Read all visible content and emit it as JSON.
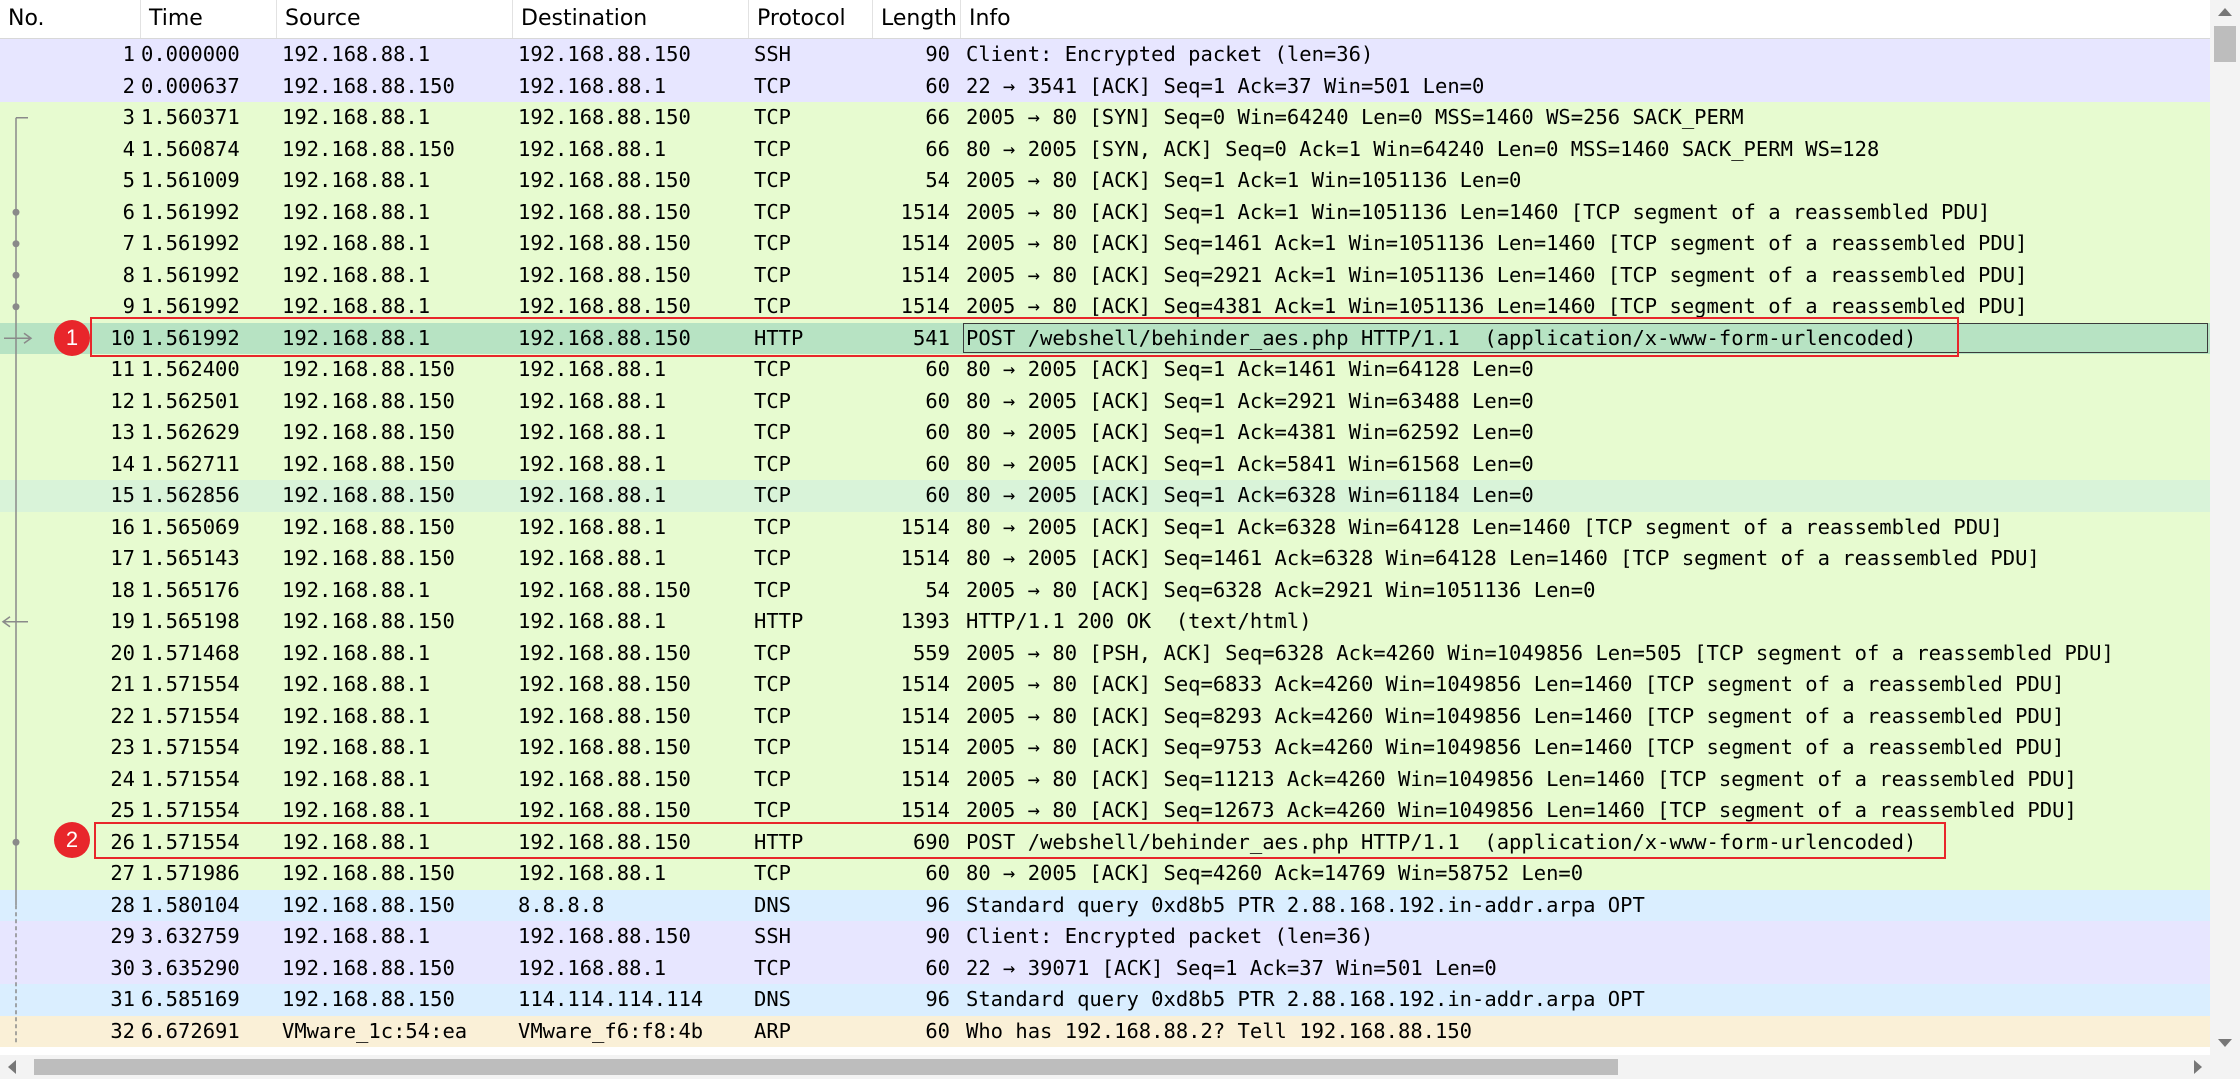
{
  "columns": {
    "no": "No.",
    "time": "Time",
    "source": "Source",
    "destination": "Destination",
    "protocol": "Protocol",
    "length": "Length",
    "info": "Info"
  },
  "annotations": [
    "1",
    "2"
  ],
  "colors": {
    "ssh": "#e7e6ff",
    "tcp": "#e7fbd0",
    "http_request": "#b7e3c3",
    "tcp_alt": "#d9f3d9",
    "dns": "#daeeff",
    "arp": "#faf0d7",
    "annotation": "#e8262b"
  },
  "packets": [
    {
      "no": "1",
      "time": "0.000000",
      "src": "192.168.88.1",
      "dst": "192.168.88.150",
      "proto": "SSH",
      "len": "90",
      "info": "Client: Encrypted packet (len=36)",
      "bg": "#e7e6ff"
    },
    {
      "no": "2",
      "time": "0.000637",
      "src": "192.168.88.150",
      "dst": "192.168.88.1",
      "proto": "TCP",
      "len": "60",
      "info": "22 → 3541 [ACK] Seq=1 Ack=37 Win=501 Len=0",
      "bg": "#e7e6ff"
    },
    {
      "no": "3",
      "time": "1.560371",
      "src": "192.168.88.1",
      "dst": "192.168.88.150",
      "proto": "TCP",
      "len": "66",
      "info": "2005 → 80 [SYN] Seq=0 Win=64240 Len=0 MSS=1460 WS=256 SACK_PERM",
      "bg": "#e7fbd0"
    },
    {
      "no": "4",
      "time": "1.560874",
      "src": "192.168.88.150",
      "dst": "192.168.88.1",
      "proto": "TCP",
      "len": "66",
      "info": "80 → 2005 [SYN, ACK] Seq=0 Ack=1 Win=64240 Len=0 MSS=1460 SACK_PERM WS=128",
      "bg": "#e7fbd0"
    },
    {
      "no": "5",
      "time": "1.561009",
      "src": "192.168.88.1",
      "dst": "192.168.88.150",
      "proto": "TCP",
      "len": "54",
      "info": "2005 → 80 [ACK] Seq=1 Ack=1 Win=1051136 Len=0",
      "bg": "#e7fbd0"
    },
    {
      "no": "6",
      "time": "1.561992",
      "src": "192.168.88.1",
      "dst": "192.168.88.150",
      "proto": "TCP",
      "len": "1514",
      "info": "2005 → 80 [ACK] Seq=1 Ack=1 Win=1051136 Len=1460 [TCP segment of a reassembled PDU]",
      "bg": "#e7fbd0"
    },
    {
      "no": "7",
      "time": "1.561992",
      "src": "192.168.88.1",
      "dst": "192.168.88.150",
      "proto": "TCP",
      "len": "1514",
      "info": "2005 → 80 [ACK] Seq=1461 Ack=1 Win=1051136 Len=1460 [TCP segment of a reassembled PDU]",
      "bg": "#e7fbd0"
    },
    {
      "no": "8",
      "time": "1.561992",
      "src": "192.168.88.1",
      "dst": "192.168.88.150",
      "proto": "TCP",
      "len": "1514",
      "info": "2005 → 80 [ACK] Seq=2921 Ack=1 Win=1051136 Len=1460 [TCP segment of a reassembled PDU]",
      "bg": "#e7fbd0"
    },
    {
      "no": "9",
      "time": "1.561992",
      "src": "192.168.88.1",
      "dst": "192.168.88.150",
      "proto": "TCP",
      "len": "1514",
      "info": "2005 → 80 [ACK] Seq=4381 Ack=1 Win=1051136 Len=1460 [TCP segment of a reassembled PDU]",
      "bg": "#e7fbd0"
    },
    {
      "no": "10",
      "time": "1.561992",
      "src": "192.168.88.1",
      "dst": "192.168.88.150",
      "proto": "HTTP",
      "len": "541",
      "info": "POST /webshell/behinder_aes.php HTTP/1.1  (application/x-www-form-urlencoded)",
      "bg": "#b7e3c3",
      "selected": true
    },
    {
      "no": "11",
      "time": "1.562400",
      "src": "192.168.88.150",
      "dst": "192.168.88.1",
      "proto": "TCP",
      "len": "60",
      "info": "80 → 2005 [ACK] Seq=1 Ack=1461 Win=64128 Len=0",
      "bg": "#e7fbd0"
    },
    {
      "no": "12",
      "time": "1.562501",
      "src": "192.168.88.150",
      "dst": "192.168.88.1",
      "proto": "TCP",
      "len": "60",
      "info": "80 → 2005 [ACK] Seq=1 Ack=2921 Win=63488 Len=0",
      "bg": "#e7fbd0"
    },
    {
      "no": "13",
      "time": "1.562629",
      "src": "192.168.88.150",
      "dst": "192.168.88.1",
      "proto": "TCP",
      "len": "60",
      "info": "80 → 2005 [ACK] Seq=1 Ack=4381 Win=62592 Len=0",
      "bg": "#e7fbd0"
    },
    {
      "no": "14",
      "time": "1.562711",
      "src": "192.168.88.150",
      "dst": "192.168.88.1",
      "proto": "TCP",
      "len": "60",
      "info": "80 → 2005 [ACK] Seq=1 Ack=5841 Win=61568 Len=0",
      "bg": "#e7fbd0"
    },
    {
      "no": "15",
      "time": "1.562856",
      "src": "192.168.88.150",
      "dst": "192.168.88.1",
      "proto": "TCP",
      "len": "60",
      "info": "80 → 2005 [ACK] Seq=1 Ack=6328 Win=61184 Len=0",
      "bg": "#d9f3d9"
    },
    {
      "no": "16",
      "time": "1.565069",
      "src": "192.168.88.150",
      "dst": "192.168.88.1",
      "proto": "TCP",
      "len": "1514",
      "info": "80 → 2005 [ACK] Seq=1 Ack=6328 Win=64128 Len=1460 [TCP segment of a reassembled PDU]",
      "bg": "#e7fbd0"
    },
    {
      "no": "17",
      "time": "1.565143",
      "src": "192.168.88.150",
      "dst": "192.168.88.1",
      "proto": "TCP",
      "len": "1514",
      "info": "80 → 2005 [ACK] Seq=1461 Ack=6328 Win=64128 Len=1460 [TCP segment of a reassembled PDU]",
      "bg": "#e7fbd0"
    },
    {
      "no": "18",
      "time": "1.565176",
      "src": "192.168.88.1",
      "dst": "192.168.88.150",
      "proto": "TCP",
      "len": "54",
      "info": "2005 → 80 [ACK] Seq=6328 Ack=2921 Win=1051136 Len=0",
      "bg": "#e7fbd0"
    },
    {
      "no": "19",
      "time": "1.565198",
      "src": "192.168.88.150",
      "dst": "192.168.88.1",
      "proto": "HTTP",
      "len": "1393",
      "info": "HTTP/1.1 200 OK  (text/html)",
      "bg": "#e7fbd0"
    },
    {
      "no": "20",
      "time": "1.571468",
      "src": "192.168.88.1",
      "dst": "192.168.88.150",
      "proto": "TCP",
      "len": "559",
      "info": "2005 → 80 [PSH, ACK] Seq=6328 Ack=4260 Win=1049856 Len=505 [TCP segment of a reassembled PDU]",
      "bg": "#e7fbd0"
    },
    {
      "no": "21",
      "time": "1.571554",
      "src": "192.168.88.1",
      "dst": "192.168.88.150",
      "proto": "TCP",
      "len": "1514",
      "info": "2005 → 80 [ACK] Seq=6833 Ack=4260 Win=1049856 Len=1460 [TCP segment of a reassembled PDU]",
      "bg": "#e7fbd0"
    },
    {
      "no": "22",
      "time": "1.571554",
      "src": "192.168.88.1",
      "dst": "192.168.88.150",
      "proto": "TCP",
      "len": "1514",
      "info": "2005 → 80 [ACK] Seq=8293 Ack=4260 Win=1049856 Len=1460 [TCP segment of a reassembled PDU]",
      "bg": "#e7fbd0"
    },
    {
      "no": "23",
      "time": "1.571554",
      "src": "192.168.88.1",
      "dst": "192.168.88.150",
      "proto": "TCP",
      "len": "1514",
      "info": "2005 → 80 [ACK] Seq=9753 Ack=4260 Win=1049856 Len=1460 [TCP segment of a reassembled PDU]",
      "bg": "#e7fbd0"
    },
    {
      "no": "24",
      "time": "1.571554",
      "src": "192.168.88.1",
      "dst": "192.168.88.150",
      "proto": "TCP",
      "len": "1514",
      "info": "2005 → 80 [ACK] Seq=11213 Ack=4260 Win=1049856 Len=1460 [TCP segment of a reassembled PDU]",
      "bg": "#e7fbd0"
    },
    {
      "no": "25",
      "time": "1.571554",
      "src": "192.168.88.1",
      "dst": "192.168.88.150",
      "proto": "TCP",
      "len": "1514",
      "info": "2005 → 80 [ACK] Seq=12673 Ack=4260 Win=1049856 Len=1460 [TCP segment of a reassembled PDU]",
      "bg": "#e7fbd0"
    },
    {
      "no": "26",
      "time": "1.571554",
      "src": "192.168.88.1",
      "dst": "192.168.88.150",
      "proto": "HTTP",
      "len": "690",
      "info": "POST /webshell/behinder_aes.php HTTP/1.1  (application/x-www-form-urlencoded)",
      "bg": "#e7fbd0"
    },
    {
      "no": "27",
      "time": "1.571986",
      "src": "192.168.88.150",
      "dst": "192.168.88.1",
      "proto": "TCP",
      "len": "60",
      "info": "80 → 2005 [ACK] Seq=4260 Ack=14769 Win=58752 Len=0",
      "bg": "#e7fbd0"
    },
    {
      "no": "28",
      "time": "1.580104",
      "src": "192.168.88.150",
      "dst": "8.8.8.8",
      "proto": "DNS",
      "len": "96",
      "info": "Standard query 0xd8b5 PTR 2.88.168.192.in-addr.arpa OPT",
      "bg": "#daeeff"
    },
    {
      "no": "29",
      "time": "3.632759",
      "src": "192.168.88.1",
      "dst": "192.168.88.150",
      "proto": "SSH",
      "len": "90",
      "info": "Client: Encrypted packet (len=36)",
      "bg": "#e7e6ff"
    },
    {
      "no": "30",
      "time": "3.635290",
      "src": "192.168.88.150",
      "dst": "192.168.88.1",
      "proto": "TCP",
      "len": "60",
      "info": "22 → 39071 [ACK] Seq=1 Ack=37 Win=501 Len=0",
      "bg": "#e7e6ff"
    },
    {
      "no": "31",
      "time": "6.585169",
      "src": "192.168.88.150",
      "dst": "114.114.114.114",
      "proto": "DNS",
      "len": "96",
      "info": "Standard query 0xd8b5 PTR 2.88.168.192.in-addr.arpa OPT",
      "bg": "#daeeff"
    },
    {
      "no": "32",
      "time": "6.672691",
      "src": "VMware_1c:54:ea",
      "dst": "VMware_f6:f8:4b",
      "proto": "ARP",
      "len": "60",
      "info": "Who has 192.168.88.2? Tell 192.168.88.150",
      "bg": "#faf0d7"
    }
  ]
}
